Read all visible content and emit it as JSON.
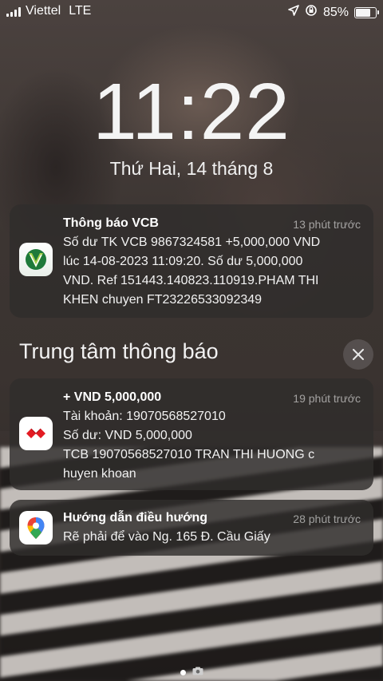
{
  "status_bar": {
    "carrier": "Viettel",
    "network": "LTE",
    "battery_percent": "85%",
    "battery_level": 0.85
  },
  "lock": {
    "time": "11:22",
    "date": "Thứ Hai, 14 tháng 8"
  },
  "pinned_notification": {
    "app": "Thông báo VCB",
    "when": "13 phút trước",
    "lines": [
      "Số dư TK VCB 9867324581 +5,000,000 VND",
      "lúc 14-08-2023 11:09:20. Số dư 5,000,000",
      "VND. Ref 151443.140823.110919.PHAM THI",
      "KHEN chuyen FT23226533092349"
    ]
  },
  "notification_center": {
    "title": "Trung tâm thông báo",
    "items": [
      {
        "title": "+ VND 5,000,000",
        "when": "19 phút trước",
        "lines": [
          "Tài khoản: 19070568527010",
          "Số dư: VND 5,000,000",
          "TCB 19070568527010 TRAN THI HUONG c",
          "huyen khoan"
        ]
      },
      {
        "title": "Hướng dẫn điều hướng",
        "when": "28 phút trước",
        "lines": [
          "Rẽ phải để vào Ng. 165 Đ. Cầu Giấy"
        ]
      }
    ]
  },
  "icons": {
    "vcb": "vcb-app-icon",
    "techcombank": "techcombank-app-icon",
    "maps": "google-maps-icon",
    "close": "close-icon",
    "camera": "camera-icon"
  }
}
